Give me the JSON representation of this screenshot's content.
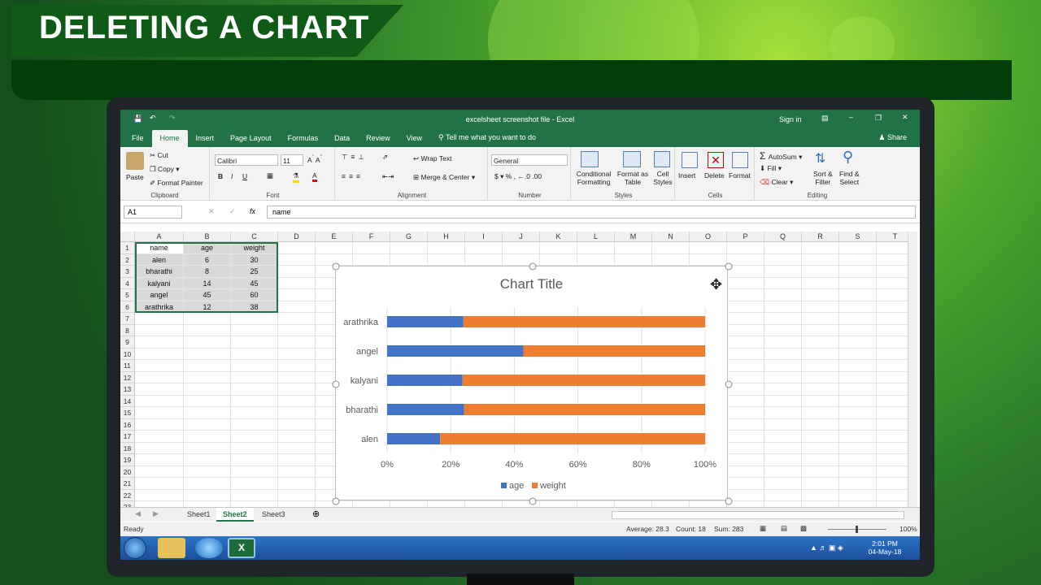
{
  "banner_title": "DELETING A CHART",
  "window": {
    "title": "excelsheet screenshot file  -  Excel",
    "sign_in": "Sign in"
  },
  "tabs": [
    "File",
    "Home",
    "Insert",
    "Page Layout",
    "Formulas",
    "Data",
    "Review",
    "View"
  ],
  "tell_me": "Tell me what you want to do",
  "share": "Share",
  "clipboard": {
    "paste": "Paste",
    "cut": "Cut",
    "copy": "Copy",
    "format_painter": "Format Painter",
    "label": "Clipboard"
  },
  "font": {
    "name": "Calibri",
    "size": "11",
    "label": "Font"
  },
  "alignment": {
    "wrap": "Wrap Text",
    "merge": "Merge & Center",
    "label": "Alignment"
  },
  "number": {
    "format": "General",
    "label": "Number"
  },
  "styles": {
    "cond": "Conditional",
    "cond2": "Formatting",
    "fmt_table": "Format as",
    "fmt_table2": "Table",
    "cell_styles": "Cell",
    "cell_styles2": "Styles",
    "label": "Styles"
  },
  "cells": {
    "insert": "Insert",
    "delete": "Delete",
    "format": "Format",
    "label": "Cells"
  },
  "editing": {
    "autosum": "AutoSum",
    "fill": "Fill",
    "clear": "Clear",
    "sort": "Sort &",
    "sort2": "Filter",
    "find": "Find &",
    "find2": "Select",
    "label": "Editing"
  },
  "formula_bar": {
    "name_box": "A1",
    "fx": "fx",
    "content": "name"
  },
  "columns": [
    "A",
    "B",
    "C",
    "D",
    "E",
    "F",
    "G",
    "H",
    "I",
    "J",
    "K",
    "L",
    "M",
    "N",
    "O",
    "P",
    "Q",
    "R",
    "S",
    "T"
  ],
  "rows": [
    "1",
    "2",
    "3",
    "4",
    "5",
    "6",
    "7",
    "8",
    "9",
    "10",
    "11",
    "12",
    "13",
    "14",
    "15",
    "16",
    "17",
    "18",
    "19",
    "20",
    "21",
    "22",
    "23"
  ],
  "table": [
    [
      "name",
      "age",
      "weight"
    ],
    [
      "alen",
      "6",
      "30"
    ],
    [
      "bharathi",
      "8",
      "25"
    ],
    [
      "kalyani",
      "14",
      "45"
    ],
    [
      "angel",
      "45",
      "60"
    ],
    [
      "arathrika",
      "12",
      "38"
    ]
  ],
  "chart_data": {
    "type": "bar",
    "stacked_percent": true,
    "title": "Chart Title",
    "categories": [
      "alen",
      "bharathi",
      "kalyani",
      "angel",
      "arathrika"
    ],
    "series": [
      {
        "name": "age",
        "values": [
          6,
          8,
          14,
          45,
          12
        ],
        "color": "#4472c4"
      },
      {
        "name": "weight",
        "values": [
          30,
          25,
          45,
          60,
          38
        ],
        "color": "#ed7d31"
      }
    ],
    "x_ticks": [
      "0%",
      "20%",
      "40%",
      "60%",
      "80%",
      "100%"
    ],
    "legend": "bottom"
  },
  "sheets": [
    "Sheet1",
    "Sheet2",
    "Sheet3"
  ],
  "status": {
    "ready": "Ready",
    "average": "Average: 28.3",
    "count": "Count: 18",
    "sum": "Sum: 283",
    "zoom": "100%"
  },
  "clock": {
    "time": "2:01 PM",
    "date": "04-May-18"
  }
}
